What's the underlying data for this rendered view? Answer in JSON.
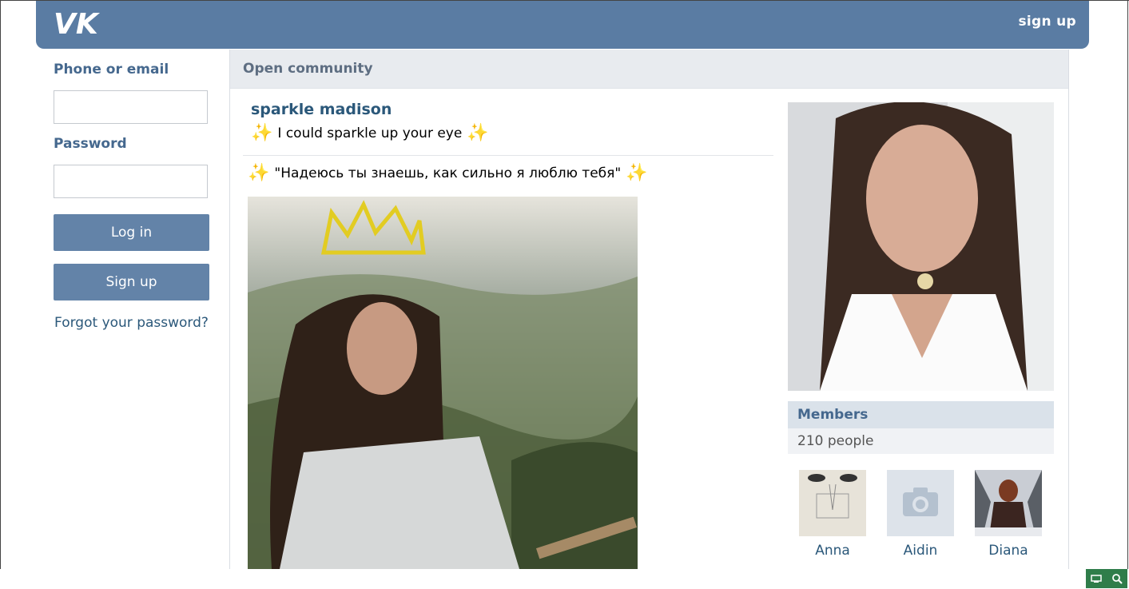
{
  "header": {
    "signup_link": "sign up",
    "logo_icon": "vk-logo-icon",
    "color": "#5a7ca3"
  },
  "login": {
    "phone_label": "Phone or email",
    "phone_value": "",
    "password_label": "Password",
    "password_value": "",
    "login_button": "Log in",
    "signup_button": "Sign up",
    "forgot_link": "Forgot your password?"
  },
  "community": {
    "type_label": "Open community",
    "name": "sparkle madison",
    "status": "I could sparkle up your eye",
    "post_text": "\"Надеюсь ты знаешь, как сильно я люблю тебя\"",
    "sparkle_icon": "sparkle-icon"
  },
  "members": {
    "title": "Members",
    "count": "210 people",
    "list": [
      {
        "name": "Anna"
      },
      {
        "name": "Aidin"
      },
      {
        "name": "Diana"
      }
    ]
  },
  "tray": {
    "icons": [
      "screen-icon",
      "zoom-icon"
    ]
  }
}
